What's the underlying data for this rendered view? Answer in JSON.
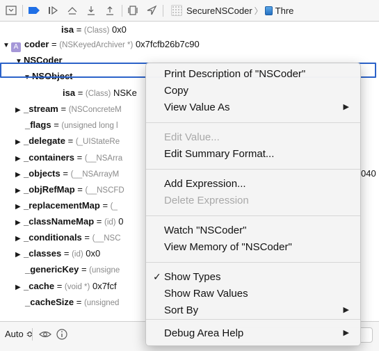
{
  "toolbar": {
    "breadcrumb": [
      "SecureNSCoder",
      "Thre"
    ]
  },
  "rows": [
    {
      "indent": 1,
      "expander": "",
      "name": "isa",
      "eq": " = ",
      "type": "(Class)",
      "value": " 0x0"
    },
    {
      "indent": 0,
      "expander": "▼",
      "badge": "A",
      "name": "coder",
      "eq": " = ",
      "type": "(NSKeyedArchiver *)",
      "value": " 0x7fcfb26b7c90"
    },
    {
      "indent": 0.5,
      "expander": "▼",
      "name": "NSCoder",
      "eq": "",
      "type": "",
      "value": ""
    },
    {
      "indent": 1,
      "expander": "▼",
      "name": "NSObject",
      "eq": "",
      "type": "",
      "value": ""
    },
    {
      "indent": 2,
      "expander": "",
      "name": "isa",
      "eq": " = ",
      "type": "(Class)",
      "value": " NSKe"
    },
    {
      "indent": 0.5,
      "expander": "▶",
      "name": "_stream",
      "eq": " = ",
      "type": "(NSConcreteM",
      "value": ""
    },
    {
      "indent": 1,
      "expander": "",
      "name": "_flags",
      "eq": " = ",
      "type": "(unsigned long l",
      "value": ""
    },
    {
      "indent": 0.5,
      "expander": "▶",
      "name": "_delegate",
      "eq": " = ",
      "type": "(_UIStateRe",
      "value": ""
    },
    {
      "indent": 0.5,
      "expander": "▶",
      "name": "_containers",
      "eq": " = ",
      "type": "(__NSArra",
      "value": ""
    },
    {
      "indent": 0.5,
      "expander": "▶",
      "name": "_objects",
      "eq": " = ",
      "type": "(__NSArrayM",
      "value": ""
    },
    {
      "indent": 0.5,
      "expander": "▶",
      "name": "_objRefMap",
      "eq": " = ",
      "type": "(__NSCFD",
      "value": ""
    },
    {
      "indent": 0.5,
      "expander": "▶",
      "name": "_replacementMap",
      "eq": " = ",
      "type": "(_",
      "value": ""
    },
    {
      "indent": 0.5,
      "expander": "▶",
      "name": "_classNameMap",
      "eq": " = ",
      "type": "(id)",
      "value": " 0"
    },
    {
      "indent": 0.5,
      "expander": "▶",
      "name": "_conditionals",
      "eq": " = ",
      "type": "(__NSC",
      "value": ""
    },
    {
      "indent": 0.5,
      "expander": "▶",
      "name": "_classes",
      "eq": " = ",
      "type": "(id)",
      "value": " 0x0"
    },
    {
      "indent": 1,
      "expander": "",
      "name": "_genericKey",
      "eq": " = ",
      "type": "(unsigne",
      "value": ""
    },
    {
      "indent": 0.5,
      "expander": "▶",
      "name": "_cache",
      "eq": " = ",
      "type": "(void *)",
      "value": " 0x7fcf"
    },
    {
      "indent": 1,
      "expander": "",
      "name": "_cacheSize",
      "eq": " = ",
      "type": "(unsigned",
      "value": ""
    }
  ],
  "trailing_value": "040",
  "bottombar": {
    "scope_label": "Auto ≎"
  },
  "menu": {
    "items": [
      {
        "label": "Print Description of \"NSCoder\"",
        "disabled": false
      },
      {
        "label": "Copy",
        "disabled": false
      },
      {
        "label": "View Value As",
        "disabled": false,
        "submenu": "▶"
      },
      {
        "label": "Edit Value...",
        "disabled": true
      },
      {
        "label": "Edit Summary Format...",
        "disabled": false
      },
      {
        "label": "Add Expression...",
        "disabled": false
      },
      {
        "label": "Delete Expression",
        "disabled": true
      },
      {
        "label": "Watch \"NSCoder\"",
        "disabled": false
      },
      {
        "label": "View Memory of \"NSCoder\"",
        "disabled": false
      },
      {
        "label": "Show Types",
        "disabled": false,
        "checked": "✓"
      },
      {
        "label": "Show Raw Values",
        "disabled": false
      },
      {
        "label": "Sort By",
        "disabled": false,
        "submenu": "▶"
      },
      {
        "label": "Debug Area Help",
        "disabled": false,
        "submenu": "▶"
      }
    ]
  },
  "colors": {
    "selection": "#2b62c9",
    "badge": "#a597d8"
  }
}
